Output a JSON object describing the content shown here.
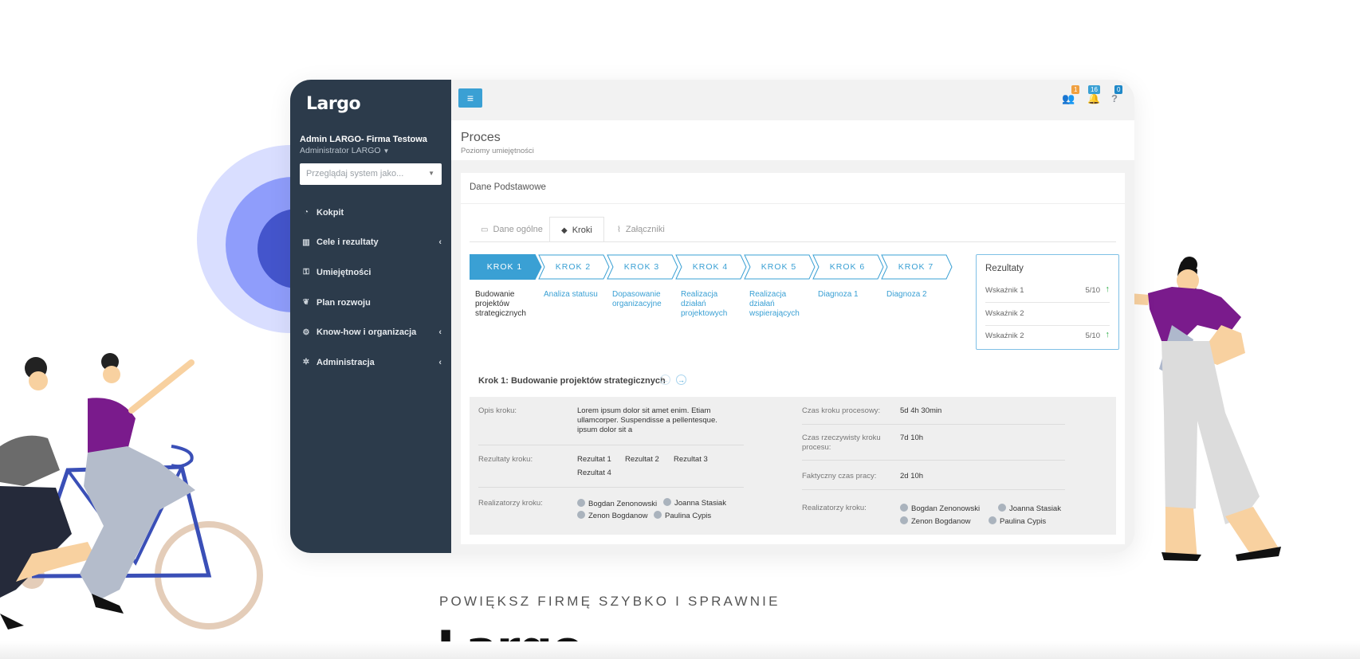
{
  "brand": {
    "logo_text": "Largo",
    "accent": "#3aa0d4",
    "sidebar_bg": "#2c3b4b"
  },
  "sidebar": {
    "user_name": "Admin LARGO- Firma Testowa",
    "user_role": "Administrator LARGO",
    "browse_placeholder": "Przeglądaj system jako...",
    "items": [
      {
        "label": "Kokpit",
        "icon": "dashboard-icon",
        "submenu": false
      },
      {
        "label": "Cele i rezultaty",
        "icon": "chart-icon",
        "submenu": true
      },
      {
        "label": "Umiejętności",
        "icon": "key-icon",
        "submenu": false
      },
      {
        "label": "Plan rozwoju",
        "icon": "leaf-icon",
        "submenu": false
      },
      {
        "label": "Know-how i organizacja",
        "icon": "cogs-icon",
        "submenu": true
      },
      {
        "label": "Administracja",
        "icon": "gear-icon",
        "submenu": true
      }
    ]
  },
  "topbar": {
    "menu_icon": "hamburger-icon",
    "users_badge": "1",
    "notifications_badge": "16",
    "help_badge": "0",
    "badge_colors": {
      "users": "#f0a040",
      "notifications": "#3aa0d4",
      "help": "#1e88c8"
    }
  },
  "page": {
    "title": "Proces",
    "subtitle": "Poziomy umiejętności"
  },
  "panel": {
    "title": "Dane Podstawowe",
    "tabs": [
      {
        "label": "Dane ogólne",
        "icon": "laptop-icon"
      },
      {
        "label": "Kroki",
        "icon": "diamond-icon"
      },
      {
        "label": "Załączniki",
        "icon": "paperclip-icon"
      }
    ],
    "active_tab": "Kroki"
  },
  "steps": [
    {
      "label": "KROK 1",
      "desc": "Budowanie projektów strategicznych"
    },
    {
      "label": "KROK 2",
      "desc": "Analiza statusu"
    },
    {
      "label": "KROK 3",
      "desc": "Dopasowanie organizacyjne"
    },
    {
      "label": "KROK 4",
      "desc": "Realizacja działań projektowych"
    },
    {
      "label": "KROK 5",
      "desc": "Realizacja działań wspierających"
    },
    {
      "label": "KROK 6",
      "desc": "Diagnoza 1"
    },
    {
      "label": "KROK 7",
      "desc": "Diagnoza 2"
    }
  ],
  "results": {
    "title": "Rezultaty",
    "rows": [
      {
        "name": "Wskaźnik 1",
        "value": "5/10"
      },
      {
        "name": "Wskaźnik 2",
        "value": ""
      },
      {
        "name": "Wskaźnik 2",
        "value": "5/10"
      }
    ]
  },
  "detail": {
    "heading": "Krok 1: Budowanie projektów strategicznych",
    "left": {
      "desc_label": "Opis kroku:",
      "desc_value": "Lorem ipsum dolor sit amet enim. Etiam ullamcorper. Suspendisse a pellentesque. ipsum dolor sit a",
      "results_label": "Rezultaty kroku:",
      "results_values": [
        "Rezultat 1",
        "Rezultat 2",
        "Rezultat 3",
        "Rezultat 4"
      ],
      "people_label": "Realizatorzy kroku:",
      "people": [
        "Bogdan Zenonowski",
        "Joanna Stasiak",
        "Zenon Bogdanow",
        "Paulina Cypis"
      ]
    },
    "right": {
      "proc_time_label": "Czas kroku procesowy:",
      "proc_time_value": "5d 4h 30min",
      "real_time_label": "Czas rzeczywisty kroku procesu:",
      "real_time_value": "7d 10h",
      "work_time_label": "Faktyczny czas pracy:",
      "work_time_value": "2d 10h",
      "people_label": "Realizatorzy kroku:",
      "people": [
        "Bogdan Zenonowski",
        "Joanna Stasiak",
        "Zenon Bogdanow",
        "Paulina Cypis"
      ]
    }
  },
  "hero": {
    "tagline": "POWIĘKSZ FIRMĘ SZYBKO I SPRAWNIE",
    "logo_text": "Largo"
  }
}
